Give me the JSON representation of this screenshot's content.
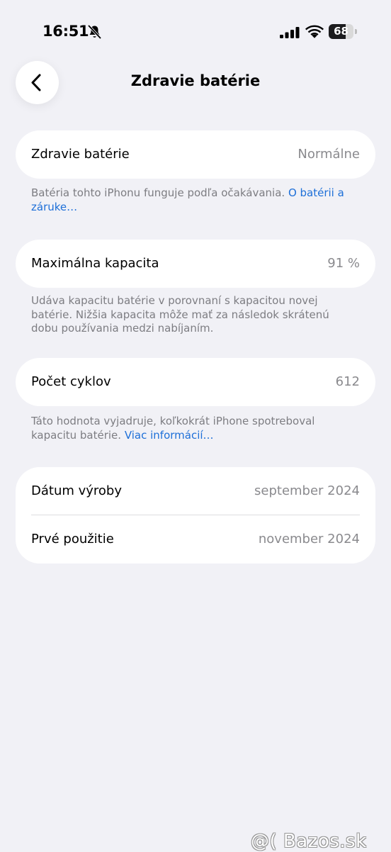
{
  "status_bar": {
    "time": "16:51",
    "battery_level": "68",
    "battery_fraction": 0.68
  },
  "header": {
    "title": "Zdravie batérie",
    "back_icon": "chevron-left-icon"
  },
  "battery_health": {
    "label": "Zdravie batérie",
    "value": "Normálne",
    "note_text": "Batéria tohto iPhonu funguje podľa očakávania. ",
    "note_link": "O batérii a záruke…"
  },
  "max_capacity": {
    "label": "Maximálna kapacita",
    "value": "91 %",
    "note_text": "Udáva kapacitu batérie v porovnaní s kapacitou novej batérie. Nižšia kapacita môže mať za následok skrátenú dobu používania medzi nabíjaním."
  },
  "cycle_count": {
    "label": "Počet cyklov",
    "value": "612",
    "note_text": "Táto hodnota vyjadruje, koľkokrát iPhone spotreboval kapacitu batérie. ",
    "note_link": "Viac informácií…"
  },
  "dates": {
    "manufacture_label": "Dátum výroby",
    "manufacture_value": "september 2024",
    "first_use_label": "Prvé použitie",
    "first_use_value": "november 2024"
  },
  "watermark": "@( Bazos.sk",
  "colors": {
    "background": "#f1f1f6",
    "card": "#ffffff",
    "link": "#1d6fd8",
    "secondary_text": "#8a8a8e"
  }
}
